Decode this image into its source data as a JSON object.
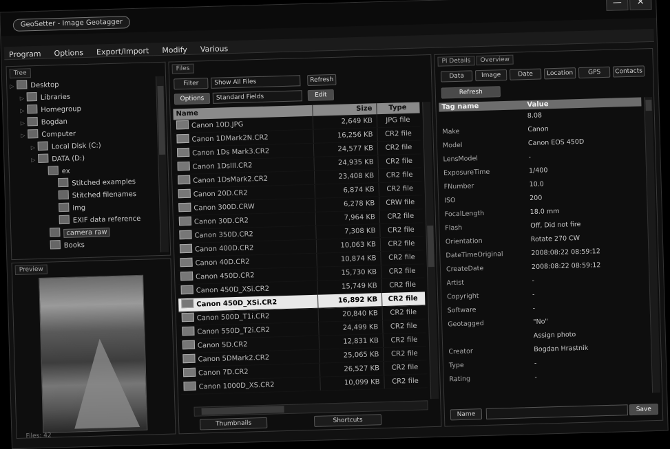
{
  "window": {
    "title": "GeoSetter - Image Geotagger",
    "controls": {
      "minimize": "—",
      "close": "✕"
    }
  },
  "menu": [
    "Program",
    "Options",
    "Export/Import",
    "Modify",
    "Various"
  ],
  "tree": {
    "tab": "Tree",
    "nodes": [
      {
        "label": "Desktop",
        "level": 0
      },
      {
        "label": "Libraries",
        "level": 1
      },
      {
        "label": "Homegroup",
        "level": 1
      },
      {
        "label": "Bogdan",
        "level": 1
      },
      {
        "label": "Computer",
        "level": 1
      },
      {
        "label": "Local Disk (C:)",
        "level": 2
      },
      {
        "label": "DATA (D:)",
        "level": 2
      },
      {
        "label": "ex",
        "level": 3
      },
      {
        "label": "Stitched examples",
        "level": 4
      },
      {
        "label": "Stitched filenames",
        "level": 4
      },
      {
        "label": "img",
        "level": 4
      },
      {
        "label": "EXIF data reference",
        "level": 4
      },
      {
        "label": "camera raw",
        "level": 3
      },
      {
        "label": "Books",
        "level": 3
      }
    ]
  },
  "preview": {
    "tab": "Preview"
  },
  "files": {
    "tab": "Files",
    "filter_button": "Filter",
    "filter_value": "Show All Files",
    "refresh_button": "Refresh",
    "options_button": "Options",
    "sort_value": "Standard Fields",
    "edit_button": "Edit",
    "columns": {
      "name": "Name",
      "size": "Size",
      "type": "Type"
    },
    "rows": [
      {
        "name": "Canon 10D.JPG",
        "size": "2,649 KB",
        "type": "JPG file"
      },
      {
        "name": "Canon 1DMark2N.CR2",
        "size": "16,256 KB",
        "type": "CR2 file"
      },
      {
        "name": "Canon 1Ds Mark3.CR2",
        "size": "24,577 KB",
        "type": "CR2 file"
      },
      {
        "name": "Canon 1DsIII.CR2",
        "size": "24,935 KB",
        "type": "CR2 file"
      },
      {
        "name": "Canon 1DsMark2.CR2",
        "size": "23,408 KB",
        "type": "CR2 file"
      },
      {
        "name": "Canon 20D.CR2",
        "size": "6,874 KB",
        "type": "CR2 file"
      },
      {
        "name": "Canon 300D.CRW",
        "size": "6,278 KB",
        "type": "CRW file"
      },
      {
        "name": "Canon 30D.CR2",
        "size": "7,964 KB",
        "type": "CR2 file"
      },
      {
        "name": "Canon 350D.CR2",
        "size": "7,308 KB",
        "type": "CR2 file"
      },
      {
        "name": "Canon 400D.CR2",
        "size": "10,063 KB",
        "type": "CR2 file"
      },
      {
        "name": "Canon 40D.CR2",
        "size": "10,874 KB",
        "type": "CR2 file"
      },
      {
        "name": "Canon 450D.CR2",
        "size": "15,730 KB",
        "type": "CR2 file"
      },
      {
        "name": "Canon 450D_XSi.CR2",
        "size": "15,749 KB",
        "type": "CR2 file"
      },
      {
        "name": "Canon 450D_XSi.CR2",
        "size": "16,892 KB",
        "type": "CR2 file"
      },
      {
        "name": "Canon 500D_T1i.CR2",
        "size": "20,840 KB",
        "type": "CR2 file"
      },
      {
        "name": "Canon 550D_T2i.CR2",
        "size": "24,499 KB",
        "type": "CR2 file"
      },
      {
        "name": "Canon 5D.CR2",
        "size": "12,831 KB",
        "type": "CR2 file"
      },
      {
        "name": "Canon 5DMark2.CR2",
        "size": "25,065 KB",
        "type": "CR2 file"
      },
      {
        "name": "Canon 7D.CR2",
        "size": "26,527 KB",
        "type": "CR2 file"
      },
      {
        "name": "Canon 1000D_XS.CR2",
        "size": "10,099 KB",
        "type": "CR2 file"
      }
    ],
    "selected_row_index": 13,
    "bottom_buttons": {
      "thumbs": "Thumbnails",
      "shortcuts": "Shortcuts"
    }
  },
  "info": {
    "tabs": [
      "Pl Details",
      "Overview"
    ],
    "subtabs": [
      "Data",
      "Image",
      "Date",
      "Location",
      "GPS",
      "Contacts"
    ],
    "action_button": "Refresh",
    "columns": {
      "name": "Tag name",
      "value": "Value"
    },
    "rows": [
      {
        "name": "",
        "value": "8.08"
      },
      {
        "name": "Make",
        "value": "Canon"
      },
      {
        "name": "Model",
        "value": "Canon EOS 450D"
      },
      {
        "name": "LensModel",
        "value": "-"
      },
      {
        "name": "ExposureTime",
        "value": "1/400"
      },
      {
        "name": "FNumber",
        "value": "10.0"
      },
      {
        "name": "ISO",
        "value": "200"
      },
      {
        "name": "FocalLength",
        "value": "18.0 mm"
      },
      {
        "name": "Flash",
        "value": "Off, Did not fire"
      },
      {
        "name": "Orientation",
        "value": "Rotate 270 CW"
      },
      {
        "name": "DateTimeOriginal",
        "value": "2008:08:22 08:59:12"
      },
      {
        "name": "CreateDate",
        "value": "2008:08:22 08:59:12"
      },
      {
        "name": "Artist",
        "value": "-"
      },
      {
        "name": "Copyright",
        "value": "-"
      },
      {
        "name": "Software",
        "value": "-"
      },
      {
        "name": "Geotagged",
        "value": "\"No\""
      },
      {
        "name": "",
        "value": "Assign photo"
      },
      {
        "name": "Creator",
        "value": "Bogdan Hrastnik"
      },
      {
        "name": "Type",
        "value": "-"
      },
      {
        "name": "Rating",
        "value": "-"
      }
    ],
    "bottom_button": "Save",
    "bottom_combo_label": "Name"
  },
  "status_text": "Files: 42",
  "colors": {
    "selection": "#e8e8e8",
    "header": "#8a8a8a",
    "background": "#111111"
  }
}
